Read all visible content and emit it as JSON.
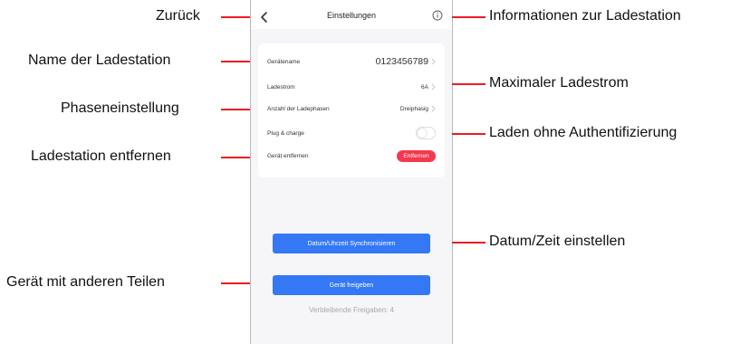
{
  "screen": {
    "title": "Einstellungen",
    "icons": {
      "back": "chevron-left-icon",
      "info": "info-circle-icon",
      "row_chevron": "chevron-right-icon"
    },
    "rows": [
      {
        "label": "Gerätename",
        "value": "0123456789"
      },
      {
        "label": "Ladestrom",
        "value": "6A"
      },
      {
        "label": "Anzahl der Ladephasen",
        "value": "Dreiphasig"
      },
      {
        "label": "Plug & charge",
        "toggle_on": false
      },
      {
        "label": "Gerät entfernen",
        "button": "Entfernen"
      }
    ],
    "sync_button": "Datum/Uhrzeit Synchronisieren",
    "share_button": "Gerät freigeben",
    "remaining_shares": "Verbleibende Freigaben: 4"
  },
  "annotations": {
    "back": "Zurück",
    "info": "Informationen zur Ladestation",
    "name": "Name der Ladestation",
    "current": "Maximaler Ladestrom",
    "phase": "Phaseneinstellung",
    "plug": "Laden ohne Authentifizierung",
    "remove": "Ladestation entfernen",
    "datetime": "Datum/Zeit einstellen",
    "share": "Gerät mit anderen Teilen"
  },
  "colors": {
    "accent_blue": "#3478f6",
    "danger_red": "#f4384e",
    "annotation_line": "#ee1b24"
  }
}
